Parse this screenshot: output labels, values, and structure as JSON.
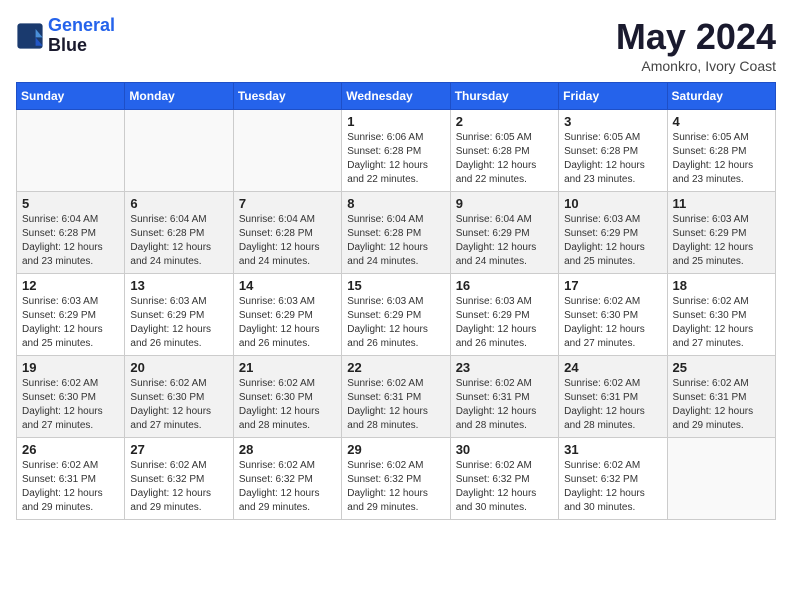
{
  "header": {
    "logo_line1": "General",
    "logo_line2": "Blue",
    "title": "May 2024",
    "location": "Amonkro, Ivory Coast"
  },
  "weekdays": [
    "Sunday",
    "Monday",
    "Tuesday",
    "Wednesday",
    "Thursday",
    "Friday",
    "Saturday"
  ],
  "weeks": [
    [
      {
        "day": "",
        "info": ""
      },
      {
        "day": "",
        "info": ""
      },
      {
        "day": "",
        "info": ""
      },
      {
        "day": "1",
        "info": "Sunrise: 6:06 AM\nSunset: 6:28 PM\nDaylight: 12 hours\nand 22 minutes."
      },
      {
        "day": "2",
        "info": "Sunrise: 6:05 AM\nSunset: 6:28 PM\nDaylight: 12 hours\nand 22 minutes."
      },
      {
        "day": "3",
        "info": "Sunrise: 6:05 AM\nSunset: 6:28 PM\nDaylight: 12 hours\nand 23 minutes."
      },
      {
        "day": "4",
        "info": "Sunrise: 6:05 AM\nSunset: 6:28 PM\nDaylight: 12 hours\nand 23 minutes."
      }
    ],
    [
      {
        "day": "5",
        "info": "Sunrise: 6:04 AM\nSunset: 6:28 PM\nDaylight: 12 hours\nand 23 minutes."
      },
      {
        "day": "6",
        "info": "Sunrise: 6:04 AM\nSunset: 6:28 PM\nDaylight: 12 hours\nand 24 minutes."
      },
      {
        "day": "7",
        "info": "Sunrise: 6:04 AM\nSunset: 6:28 PM\nDaylight: 12 hours\nand 24 minutes."
      },
      {
        "day": "8",
        "info": "Sunrise: 6:04 AM\nSunset: 6:28 PM\nDaylight: 12 hours\nand 24 minutes."
      },
      {
        "day": "9",
        "info": "Sunrise: 6:04 AM\nSunset: 6:29 PM\nDaylight: 12 hours\nand 24 minutes."
      },
      {
        "day": "10",
        "info": "Sunrise: 6:03 AM\nSunset: 6:29 PM\nDaylight: 12 hours\nand 25 minutes."
      },
      {
        "day": "11",
        "info": "Sunrise: 6:03 AM\nSunset: 6:29 PM\nDaylight: 12 hours\nand 25 minutes."
      }
    ],
    [
      {
        "day": "12",
        "info": "Sunrise: 6:03 AM\nSunset: 6:29 PM\nDaylight: 12 hours\nand 25 minutes."
      },
      {
        "day": "13",
        "info": "Sunrise: 6:03 AM\nSunset: 6:29 PM\nDaylight: 12 hours\nand 26 minutes."
      },
      {
        "day": "14",
        "info": "Sunrise: 6:03 AM\nSunset: 6:29 PM\nDaylight: 12 hours\nand 26 minutes."
      },
      {
        "day": "15",
        "info": "Sunrise: 6:03 AM\nSunset: 6:29 PM\nDaylight: 12 hours\nand 26 minutes."
      },
      {
        "day": "16",
        "info": "Sunrise: 6:03 AM\nSunset: 6:29 PM\nDaylight: 12 hours\nand 26 minutes."
      },
      {
        "day": "17",
        "info": "Sunrise: 6:02 AM\nSunset: 6:30 PM\nDaylight: 12 hours\nand 27 minutes."
      },
      {
        "day": "18",
        "info": "Sunrise: 6:02 AM\nSunset: 6:30 PM\nDaylight: 12 hours\nand 27 minutes."
      }
    ],
    [
      {
        "day": "19",
        "info": "Sunrise: 6:02 AM\nSunset: 6:30 PM\nDaylight: 12 hours\nand 27 minutes."
      },
      {
        "day": "20",
        "info": "Sunrise: 6:02 AM\nSunset: 6:30 PM\nDaylight: 12 hours\nand 27 minutes."
      },
      {
        "day": "21",
        "info": "Sunrise: 6:02 AM\nSunset: 6:30 PM\nDaylight: 12 hours\nand 28 minutes."
      },
      {
        "day": "22",
        "info": "Sunrise: 6:02 AM\nSunset: 6:31 PM\nDaylight: 12 hours\nand 28 minutes."
      },
      {
        "day": "23",
        "info": "Sunrise: 6:02 AM\nSunset: 6:31 PM\nDaylight: 12 hours\nand 28 minutes."
      },
      {
        "day": "24",
        "info": "Sunrise: 6:02 AM\nSunset: 6:31 PM\nDaylight: 12 hours\nand 28 minutes."
      },
      {
        "day": "25",
        "info": "Sunrise: 6:02 AM\nSunset: 6:31 PM\nDaylight: 12 hours\nand 29 minutes."
      }
    ],
    [
      {
        "day": "26",
        "info": "Sunrise: 6:02 AM\nSunset: 6:31 PM\nDaylight: 12 hours\nand 29 minutes."
      },
      {
        "day": "27",
        "info": "Sunrise: 6:02 AM\nSunset: 6:32 PM\nDaylight: 12 hours\nand 29 minutes."
      },
      {
        "day": "28",
        "info": "Sunrise: 6:02 AM\nSunset: 6:32 PM\nDaylight: 12 hours\nand 29 minutes."
      },
      {
        "day": "29",
        "info": "Sunrise: 6:02 AM\nSunset: 6:32 PM\nDaylight: 12 hours\nand 29 minutes."
      },
      {
        "day": "30",
        "info": "Sunrise: 6:02 AM\nSunset: 6:32 PM\nDaylight: 12 hours\nand 30 minutes."
      },
      {
        "day": "31",
        "info": "Sunrise: 6:02 AM\nSunset: 6:32 PM\nDaylight: 12 hours\nand 30 minutes."
      },
      {
        "day": "",
        "info": ""
      }
    ]
  ]
}
